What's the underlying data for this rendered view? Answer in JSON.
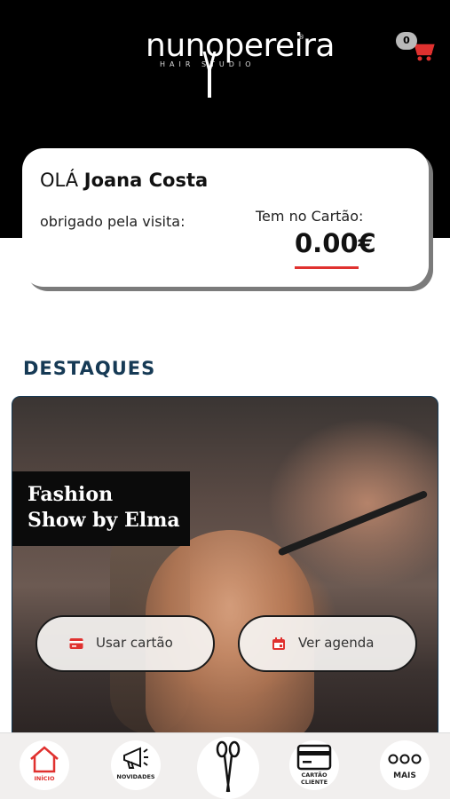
{
  "header": {
    "logo_word": "nunopereira",
    "logo_sub": "HAIR STUDIO",
    "logo_reg": "®",
    "cart_count": "0",
    "cart_icon": "shopping-cart-icon",
    "accent": "#e0312f"
  },
  "welcome": {
    "greeting": "OLÁ",
    "name": "Joana Costa",
    "thanks": "obrigado pela visita:",
    "balance_label": "Tem no Cartão:",
    "balance": "0.00€"
  },
  "featured": {
    "section_title": "DESTAQUES",
    "title_line1": "Fashion",
    "title_line2": "Show by Elma",
    "use_card_label": "Usar cartão",
    "use_card_icon": "credit-card-icon",
    "agenda_label": "Ver agenda",
    "agenda_icon": "calendar-icon",
    "title_color": "#163a55"
  },
  "nav": {
    "inicio": "INÍCIO",
    "novidades": "NOVIDADES",
    "cartao_line1": "CARTÃO",
    "cartao_line2": "CLIENTE",
    "mais": "MAIS",
    "icons": [
      "home-icon",
      "megaphone-icon",
      "scissors-icon",
      "card-icon",
      "more-dots-icon"
    ]
  }
}
